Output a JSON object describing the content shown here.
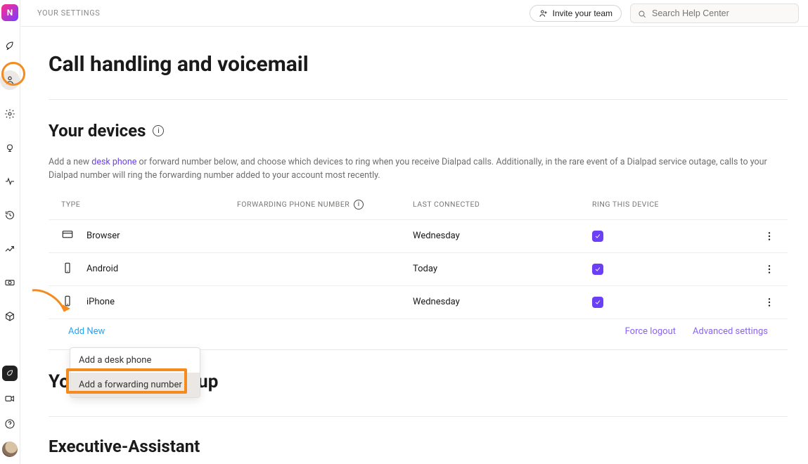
{
  "header": {
    "breadcrumb": "YOUR SETTINGS",
    "invite_label": "Invite your team",
    "search_placeholder": "Search Help Center"
  },
  "page": {
    "title": "Call handling and voicemail"
  },
  "devices": {
    "title": "Your devices",
    "description_pre": "Add a new ",
    "description_link": "desk phone",
    "description_post": " or forward number below, and choose which devices to ring when you receive Dialpad calls. Additionally, in the rare event of a Dialpad service outage, calls to your Dialpad number will ring the forwarding number added to your account most recently.",
    "columns": {
      "type": "TYPE",
      "forwarding": "FORWARDING PHONE NUMBER",
      "last": "LAST CONNECTED",
      "ring": "RING THIS DEVICE"
    },
    "rows": [
      {
        "icon": "browser",
        "type": "Browser",
        "forwarding": "",
        "last": "Wednesday",
        "ring": true
      },
      {
        "icon": "android",
        "type": "Android",
        "forwarding": "",
        "last": "Today",
        "ring": true
      },
      {
        "icon": "iphone",
        "type": "iPhone",
        "forwarding": "",
        "last": "Wednesday",
        "ring": true
      }
    ],
    "add_new": "Add New",
    "footer_links": {
      "force_logout": "Force logout",
      "advanced": "Advanced settings"
    },
    "dropdown": {
      "items": [
        {
          "label": "Add a desk phone",
          "highlight": false
        },
        {
          "label": "Add a forwarding number",
          "highlight": true
        }
      ]
    }
  },
  "sections": {
    "coaching": "Your coaching group",
    "exec": "Executive-Assistant"
  }
}
